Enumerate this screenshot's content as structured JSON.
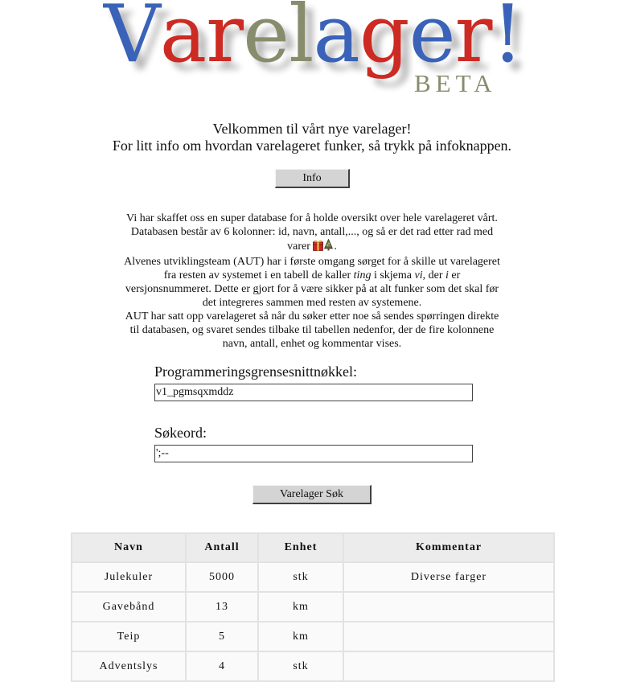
{
  "logo": {
    "letters": [
      {
        "ch": "V",
        "color": "#3a62b8"
      },
      {
        "ch": "a",
        "color": "#cc2a22"
      },
      {
        "ch": "r",
        "color": "#cc2a22"
      },
      {
        "ch": "e",
        "color": "#878d6c"
      },
      {
        "ch": "l",
        "color": "#878d6c"
      },
      {
        "ch": "a",
        "color": "#3a62b8"
      },
      {
        "ch": "g",
        "color": "#cc2a22"
      },
      {
        "ch": "e",
        "color": "#3a62b8"
      },
      {
        "ch": "r",
        "color": "#cc2a22"
      },
      {
        "ch": "!",
        "color": "#3a62b8"
      }
    ],
    "beta": "BETA",
    "beta_color": "#878d6c"
  },
  "welcome": {
    "line1": "Velkommen til vårt nye varelager!",
    "line2": "For litt info om hvordan varelageret funker, så trykk på infoknappen."
  },
  "info_button": "Info",
  "description": {
    "p1": "Vi har skaffet oss en super database for å holde oversikt over hele varelageret vårt. Databasen består av 6 kolonner: id, navn, antall,..., og så er det rad etter rad med varer",
    "p1_end": ".",
    "p2_a": "Alvenes utviklingsteam (AUT) har i første omgang sørget for å skille ut varelageret fra resten av systemet i en tabell de kaller ",
    "p2_ting": "ting",
    "p2_b": " i skjema ",
    "p2_vi": "vi",
    "p2_c": ", der ",
    "p2_i": "i",
    "p2_d": " er versjonsnummeret. Dette er gjort for å være sikker på at alt funker som det skal før det integreres sammen med resten av systemene.",
    "p3": "AUT har satt opp varelageret så når du søker etter noe så sendes spørringen direkte til databasen, og svaret sendes tilbake til tabellen nedenfor, der de fire kolonnene navn, antall, enhet og kommentar vises."
  },
  "form": {
    "api_key_label": "Programmeringsgrensesnittnøkkel:",
    "api_key_value": "v1_pgmsqxmddz",
    "search_label": "Søkeord:",
    "search_value": "';--",
    "search_button": "Varelager Søk"
  },
  "table": {
    "headers": [
      "Navn",
      "Antall",
      "Enhet",
      "Kommentar"
    ],
    "rows": [
      [
        "Julekuler",
        "5000",
        "stk",
        "Diverse farger"
      ],
      [
        "Gavebånd",
        "13",
        "km",
        ""
      ],
      [
        "Teip",
        "5",
        "km",
        ""
      ],
      [
        "Adventslys",
        "4",
        "stk",
        ""
      ]
    ]
  },
  "icons": [
    "gift-icon",
    "christmas-tree-icon"
  ]
}
